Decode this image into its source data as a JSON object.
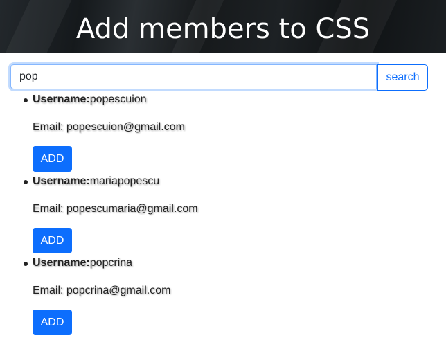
{
  "header": {
    "title": "Add members to CSS"
  },
  "search": {
    "value": "pop",
    "button_label": "search"
  },
  "results": [
    {
      "username_label": "Username:",
      "username": "popescuion",
      "email_label": "Email: ",
      "email": "popescuion@gmail.com",
      "add_label": "ADD"
    },
    {
      "username_label": "Username:",
      "username": "mariapopescu",
      "email_label": "Email: ",
      "email": "popescumaria@gmail.com",
      "add_label": "ADD"
    },
    {
      "username_label": "Username:",
      "username": "popcrina",
      "email_label": "Email: ",
      "email": "popcrina@gmail.com",
      "add_label": "ADD"
    }
  ],
  "colors": {
    "primary": "#0d6efd",
    "header_bg": "#1b1f22",
    "focus_border": "#86b7fe"
  }
}
